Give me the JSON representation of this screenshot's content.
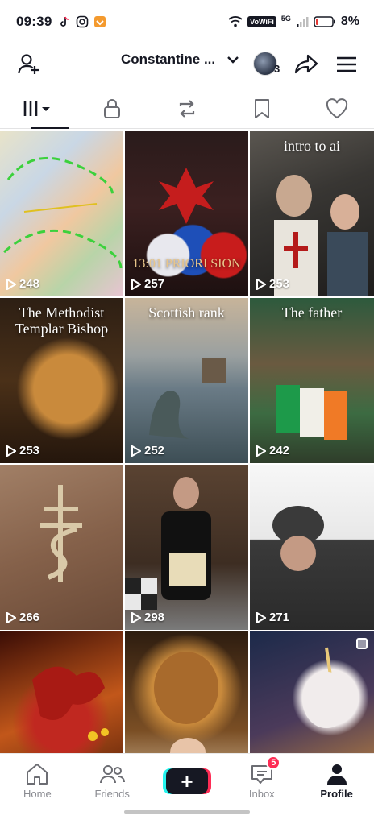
{
  "status_bar": {
    "time": "09:39",
    "left_icons": [
      "tiktok-icon",
      "instagram-icon",
      "app-icon"
    ],
    "vowifi": "VoWiFi",
    "network": "5G",
    "battery_percent": "8%"
  },
  "header": {
    "username": "Constantine ...",
    "avatar_count": "3"
  },
  "tabs": [
    "videos-grid-icon",
    "lock-icon",
    "repost-icon",
    "bookmark-icon",
    "heart-icon"
  ],
  "grid": {
    "items": [
      {
        "caption": "",
        "views": "248"
      },
      {
        "caption": "13:01 PRIORI SION",
        "views": "257"
      },
      {
        "caption": "intro to ai",
        "views": "253"
      },
      {
        "caption": "The Methodist Templar Bishop",
        "views": "253"
      },
      {
        "caption": "Scottish rank",
        "views": "252"
      },
      {
        "caption": "The father",
        "views": "242"
      },
      {
        "caption": "",
        "views": "266"
      },
      {
        "caption": "",
        "views": "298"
      },
      {
        "caption": "",
        "views": "271"
      },
      {
        "caption": "",
        "views": ""
      },
      {
        "caption": "",
        "views": ""
      },
      {
        "caption": "",
        "views": ""
      }
    ]
  },
  "bottom_nav": {
    "home": "Home",
    "friends": "Friends",
    "inbox": "Inbox",
    "inbox_badge": "5",
    "profile": "Profile"
  },
  "colors": {
    "accent_red": "#fe2c55",
    "accent_cyan": "#25f4ee",
    "text": "#161823"
  }
}
